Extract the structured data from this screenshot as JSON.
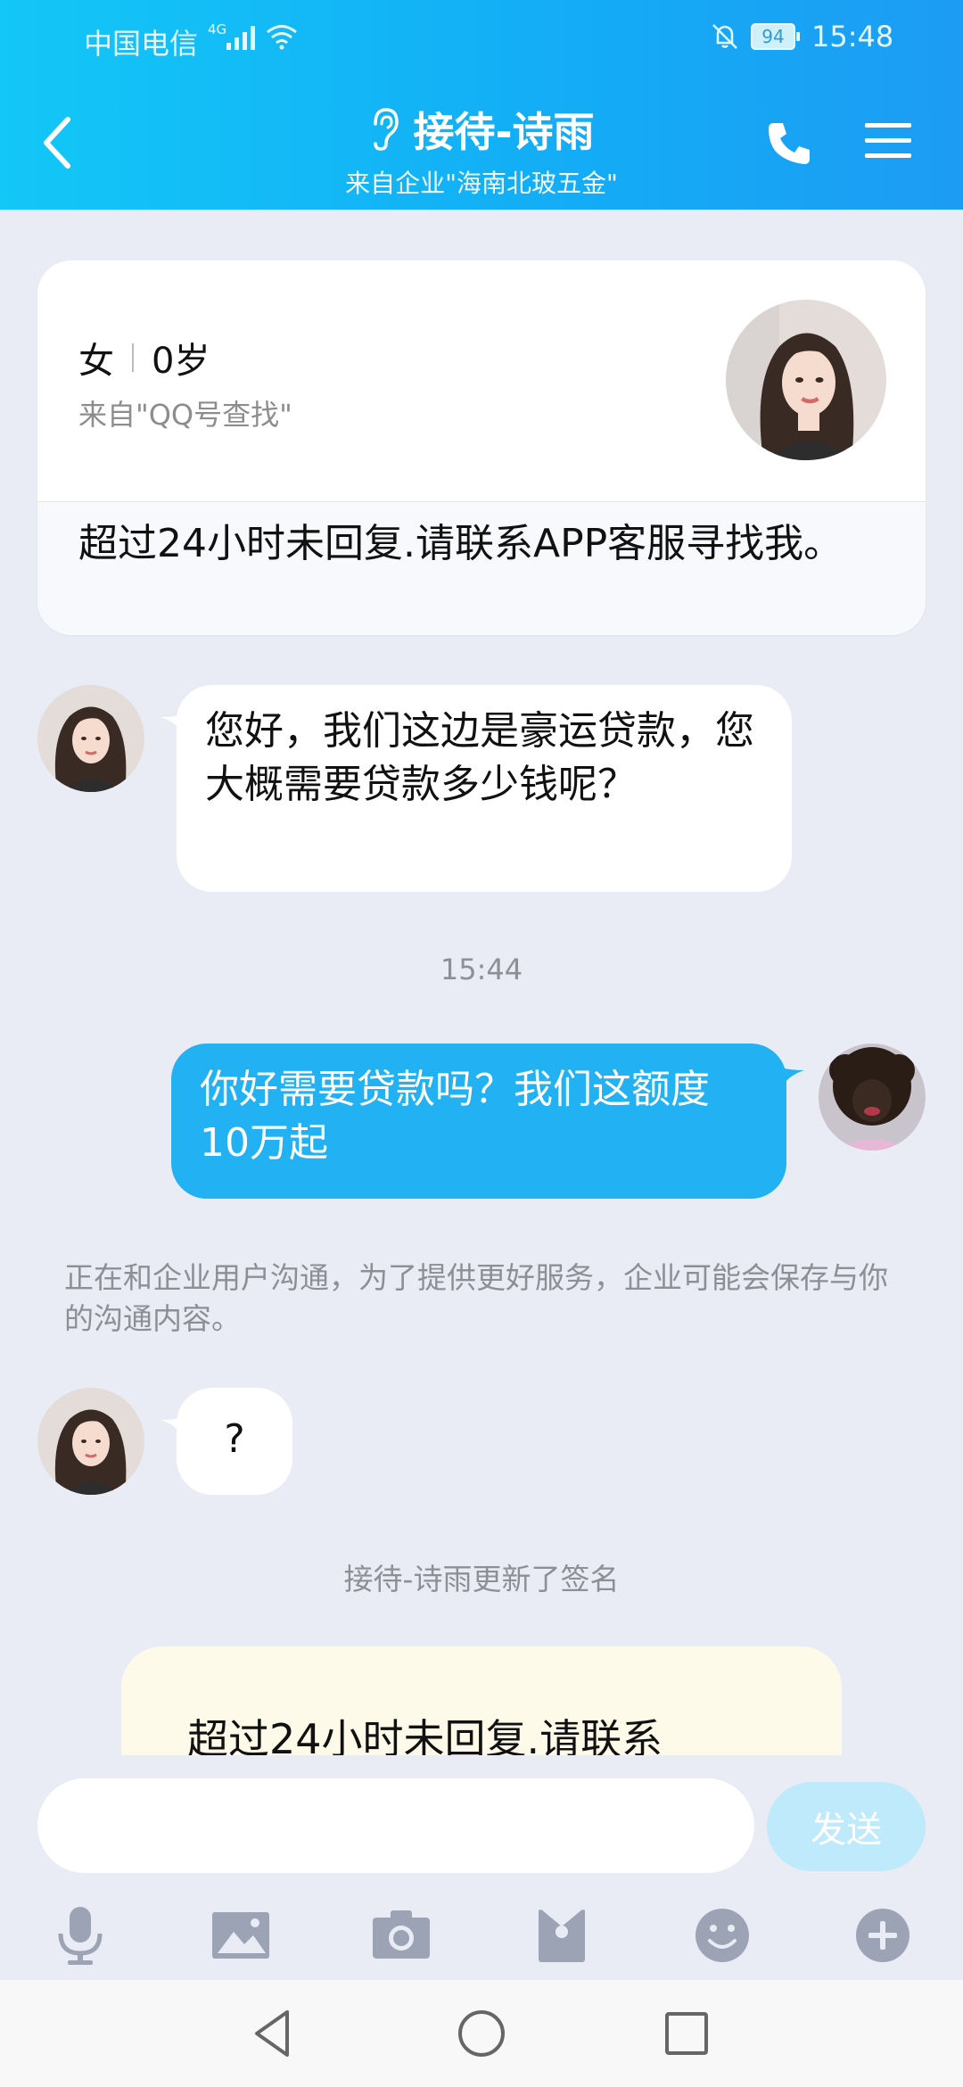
{
  "status_bar": {
    "carrier": "中国电信",
    "network": "4G",
    "battery": "94",
    "time": "15:48"
  },
  "header": {
    "title": "接待-诗雨",
    "subtitle": "来自企业\"海南北玻五金\""
  },
  "profile": {
    "gender": "女",
    "age": "0岁",
    "from": "来自\"QQ号查找\"",
    "signature": " 超过24小时未回复.请联系APP客服寻找我。"
  },
  "messages": [
    {
      "side": "left",
      "text": "您好，我们这边是豪运贷款，您大概需要贷款多少钱呢？"
    },
    {
      "timestamp": "15:44"
    },
    {
      "side": "right",
      "text": "你好需要贷款吗？我们这额度10万起"
    },
    {
      "notice": "正在和企业用户沟通，为了提供更好服务，企业可能会保存与你的沟通内容。"
    },
    {
      "side": "left",
      "text": "?"
    },
    {
      "system": "接待-诗雨更新了签名"
    },
    {
      "signature_card": "超过24小时未回复.请联系"
    }
  ],
  "input": {
    "send_label": "发送"
  },
  "colors": {
    "header_gradient_start": "#13c7f7",
    "header_gradient_end": "#1c9cf3",
    "bubble_out": "#22b1f2",
    "bubble_in": "#ffffff",
    "background": "#e9ecf5",
    "send_disabled": "#bfeafb"
  }
}
